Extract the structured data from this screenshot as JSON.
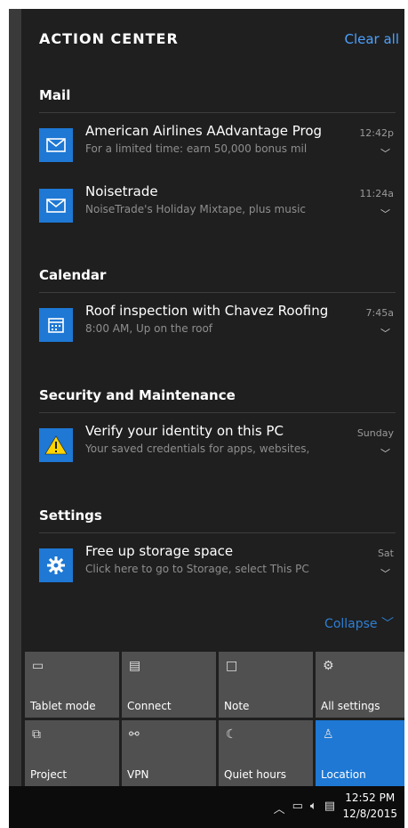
{
  "header": {
    "title": "ACTION CENTER",
    "clear_all": "Clear all"
  },
  "groups": [
    {
      "name": "Mail",
      "items": [
        {
          "icon": "mail-icon",
          "title": "American Airlines AAdvantage Prog",
          "body": "For a limited time: earn 50,000 bonus mil",
          "time": "12:42p"
        },
        {
          "icon": "mail-icon",
          "title": "Noisetrade",
          "body": "NoiseTrade's Holiday Mixtape, plus music",
          "time": "11:24a"
        }
      ]
    },
    {
      "name": "Calendar",
      "items": [
        {
          "icon": "calendar-icon",
          "title": "Roof inspection with Chavez Roofing",
          "body": "8:00 AM, Up on the roof",
          "time": "7:45a"
        }
      ]
    },
    {
      "name": "Security and Maintenance",
      "items": [
        {
          "icon": "warning-icon",
          "title": "Verify your identity on this PC",
          "body": "Your saved credentials for apps, websites,",
          "time": "Sunday"
        }
      ]
    },
    {
      "name": "Settings",
      "items": [
        {
          "icon": "gear-icon",
          "title": "Free up storage space",
          "body": "Click here to go to Storage, select This PC",
          "time": "Sat"
        }
      ]
    }
  ],
  "collapse": "Collapse",
  "quick_actions": [
    {
      "label": "Tablet mode",
      "icon": "tablet-mode-icon",
      "active": false
    },
    {
      "label": "Connect",
      "icon": "connect-icon",
      "active": false
    },
    {
      "label": "Note",
      "icon": "note-icon",
      "active": false
    },
    {
      "label": "All settings",
      "icon": "gear-icon",
      "active": false
    },
    {
      "label": "Project",
      "icon": "project-icon",
      "active": false
    },
    {
      "label": "VPN",
      "icon": "vpn-icon",
      "active": false
    },
    {
      "label": "Quiet hours",
      "icon": "moon-icon",
      "active": false
    },
    {
      "label": "Location",
      "icon": "location-icon",
      "active": true
    }
  ],
  "taskbar": {
    "time": "12:52 PM",
    "date": "12/8/2015"
  },
  "colors": {
    "accent": "#1e78d4",
    "panel": "#1f1f1f",
    "tile": "#505050",
    "link": "#4ca1ff"
  }
}
